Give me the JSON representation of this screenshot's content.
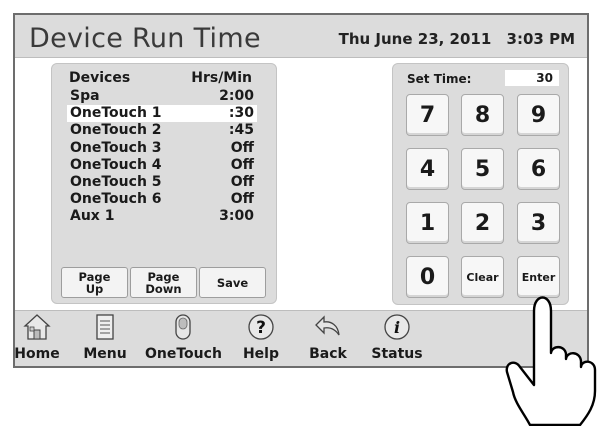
{
  "header": {
    "title": "Device Run Time",
    "date": "Thu June 23, 2011",
    "time": "3:03 PM"
  },
  "devices": {
    "col_device": "Devices",
    "col_hours": "Hrs/Min",
    "rows": [
      {
        "name": "Spa",
        "value": "2:00",
        "selected": false
      },
      {
        "name": "OneTouch 1",
        "value": ":30",
        "selected": true
      },
      {
        "name": "OneTouch 2",
        "value": ":45",
        "selected": false
      },
      {
        "name": "OneTouch 3",
        "value": "Off",
        "selected": false
      },
      {
        "name": "OneTouch 4",
        "value": "Off",
        "selected": false
      },
      {
        "name": "OneTouch 5",
        "value": "Off",
        "selected": false
      },
      {
        "name": "OneTouch 6",
        "value": "Off",
        "selected": false
      },
      {
        "name": "Aux 1",
        "value": "3:00",
        "selected": false
      }
    ],
    "buttons": {
      "page_up": "Page Up",
      "page_down": "Page Down",
      "save": "Save"
    }
  },
  "keypad": {
    "set_time_label": "Set Time:",
    "set_time_value": "30",
    "keys": [
      "7",
      "8",
      "9",
      "4",
      "5",
      "6",
      "1",
      "2",
      "3"
    ],
    "zero": "0",
    "clear": "Clear",
    "enter": "Enter"
  },
  "toolbar": {
    "items": [
      {
        "label": "Home",
        "icon": "house-icon"
      },
      {
        "label": "Menu",
        "icon": "notepad-icon"
      },
      {
        "label": "OneTouch",
        "icon": "onetouch-icon"
      },
      {
        "label": "Help",
        "icon": "help-icon"
      },
      {
        "label": "Back",
        "icon": "back-arrow-icon"
      },
      {
        "label": "Status",
        "icon": "info-icon"
      }
    ]
  },
  "colors": {
    "frame": "#dcdcdc",
    "panel": "#dcdcdc",
    "content_bg": "#ffffff",
    "text": "#1a1a1a"
  }
}
